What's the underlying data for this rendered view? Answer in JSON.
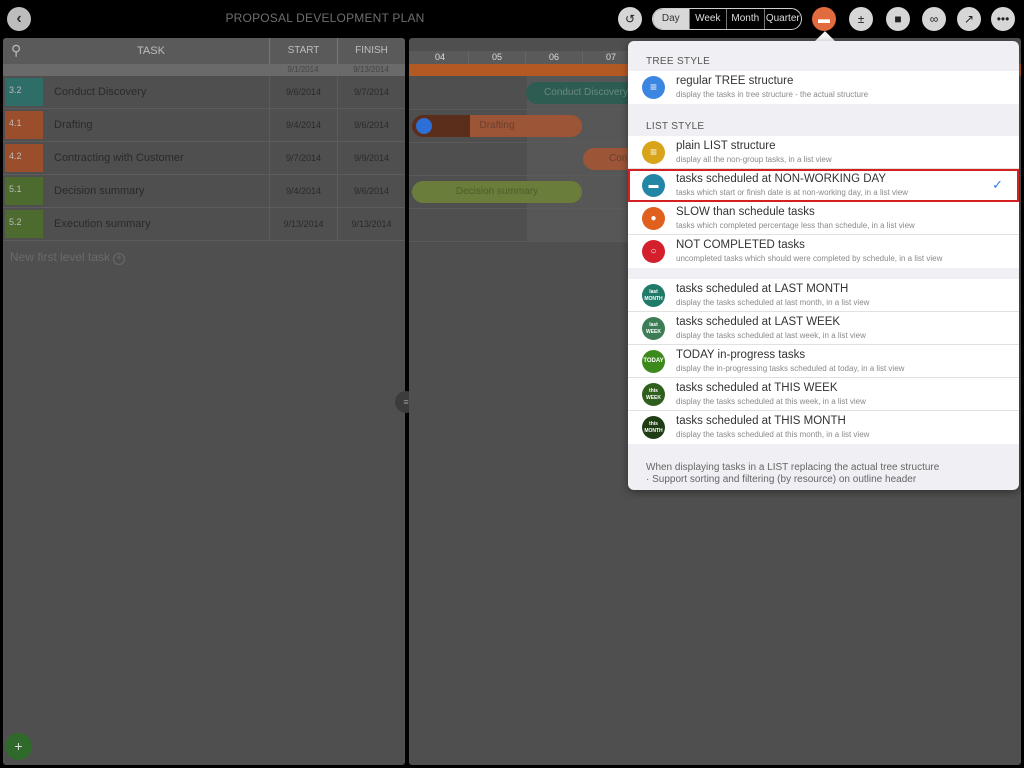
{
  "toolbar": {
    "back_icon": "chevron-left-icon",
    "title": "PROPOSAL DEVELOPMENT PLAN",
    "undo_icon": "undo-icon",
    "scale": [
      "Day",
      "Week",
      "Month",
      "Quarter"
    ],
    "selected_scale": "Day",
    "view_icon": "filter-view-icon",
    "baseline_icon": "split-icon",
    "lock_icon": "lock-icon",
    "link_icon": "link-icon",
    "share_icon": "share-icon",
    "more_icon": "more-icon"
  },
  "task_table": {
    "headers": {
      "task": "TASK",
      "start": "START",
      "finish": "FINISH"
    },
    "project_start": "9/1/2014",
    "project_finish": "9/13/2014",
    "rows": [
      {
        "wbs": "3.2",
        "name": "Conduct Discovery",
        "start": "9/6/2014",
        "finish": "9/7/2014",
        "color": "#2f6e68"
      },
      {
        "wbs": "4.1",
        "name": "Drafting",
        "start": "9/4/2014",
        "finish": "9/6/2014",
        "color": "#9a4e2b"
      },
      {
        "wbs": "4.2",
        "name": "Contracting with Customer",
        "start": "9/7/2014",
        "finish": "9/9/2014",
        "color": "#9a4e2b"
      },
      {
        "wbs": "5.1",
        "name": "Decision summary",
        "start": "9/4/2014",
        "finish": "9/6/2014",
        "color": "#4e6b2f"
      },
      {
        "wbs": "5.2",
        "name": "Execution summary",
        "start": "9/13/2014",
        "finish": "9/13/2014",
        "color": "#4e6b2f"
      }
    ],
    "new_task_label": "New first level task",
    "new_task_plus": "+"
  },
  "gantt": {
    "days": [
      "04",
      "05",
      "06",
      "07"
    ],
    "bars": [
      {
        "label": "Conduct Discovery",
        "color": "#3d8a76"
      },
      {
        "label": "Drafting",
        "color": "#e27a4e"
      },
      {
        "label": "Con",
        "color": "#e27a4e"
      },
      {
        "label": "Decision summary",
        "color": "#92b543"
      }
    ]
  },
  "popover": {
    "tree_section": "TREE STYLE",
    "list_section": "LIST STYLE",
    "tree_items": [
      {
        "title": "regular TREE structure",
        "subtitle": "display the tasks in tree structure - the actual structure",
        "icon": "tree-icon",
        "color": "#3a86e0",
        "glyph": "≡"
      }
    ],
    "list_items_a": [
      {
        "title": "plain LIST structure",
        "subtitle": "display all the non-group tasks, in a list view",
        "icon": "list-icon",
        "color": "#d8a51a",
        "glyph": "≡"
      },
      {
        "title": "tasks scheduled at NON-WORKING DAY",
        "subtitle": "tasks which start or finish date is at non-working day, in a list view",
        "icon": "bed-icon",
        "color": "#2486a6",
        "glyph": "▬",
        "selected": true
      },
      {
        "title": "SLOW than schedule tasks",
        "subtitle": "tasks which completed percentage less than schedule, in a list view",
        "icon": "turtle-icon",
        "color": "#e0601e",
        "glyph": "●"
      },
      {
        "title": "NOT COMPLETED tasks",
        "subtitle": "uncompleted tasks which should were completed by schedule, in a list view",
        "icon": "incomplete-icon",
        "color": "#d41f2d",
        "glyph": "○"
      }
    ],
    "list_items_b": [
      {
        "title": "tasks scheduled at LAST MONTH",
        "subtitle": "display the tasks scheduled at last month, in a list view",
        "icon": "last-month-icon",
        "color": "#1f7a6a",
        "glyph": "last MONTH"
      },
      {
        "title": "tasks scheduled at LAST WEEK",
        "subtitle": "display the tasks scheduled at last week, in a list view",
        "icon": "last-week-icon",
        "color": "#3c7d56",
        "glyph": "last WEEK"
      },
      {
        "title": "TODAY in-progress tasks",
        "subtitle": "display the in-progressing tasks scheduled at today, in a list view",
        "icon": "today-icon",
        "color": "#3c8a1c",
        "glyph": "TODAY"
      },
      {
        "title": "tasks scheduled at THIS WEEK",
        "subtitle": "display the tasks scheduled at this week, in a list view",
        "icon": "this-week-icon",
        "color": "#2f5f1c",
        "glyph": "this WEEK"
      },
      {
        "title": "tasks scheduled at THIS MONTH",
        "subtitle": "display the tasks scheduled at this month, in a list view",
        "icon": "this-month-icon",
        "color": "#1f3d14",
        "glyph": "this MONTH"
      }
    ],
    "footnote_1": "When displaying tasks in a LIST replacing the actual tree structure",
    "footnote_2": "· Support sorting and filtering (by resource) on outline header",
    "check_glyph": "✓"
  }
}
